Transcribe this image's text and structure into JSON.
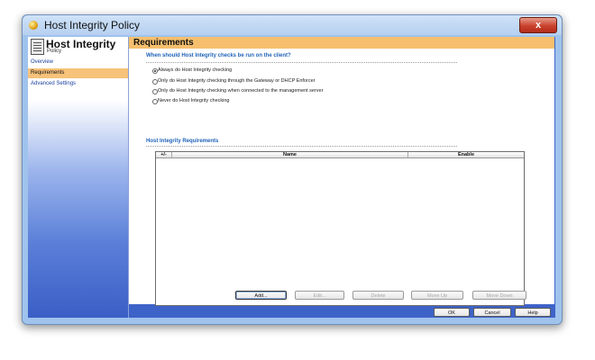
{
  "window": {
    "title": "Host Integrity Policy",
    "close_label": "x"
  },
  "sidebar": {
    "title": "Host Integrity",
    "subtitle": "Policy",
    "items": [
      {
        "label": "Overview"
      },
      {
        "label": "Requirements"
      },
      {
        "label": "Advanced Settings"
      }
    ]
  },
  "main": {
    "header": "Requirements",
    "question": "When should Host Integrity checks be run on the client?",
    "options": [
      {
        "label": "Always do Host Integrity checking",
        "selected": true
      },
      {
        "label": "Only do Host Integrity checking through the Gateway or DHCP Enforcer",
        "selected": false
      },
      {
        "label": "Only do Host Integrity checking when connected to the management server",
        "selected": false
      },
      {
        "label": "Never do Host Integrity checking",
        "selected": false
      }
    ],
    "section_title": "Host Integrity Requirements",
    "table": {
      "columns": [
        "+/-",
        "Name",
        "Enable"
      ],
      "rows": []
    },
    "actions": {
      "add": "Add...",
      "edit": "Edit...",
      "delete": "Delete",
      "move_up": "Move Up",
      "move_down": "Move Down"
    }
  },
  "footer": {
    "ok": "OK",
    "cancel": "Cancel",
    "help": "Help"
  }
}
